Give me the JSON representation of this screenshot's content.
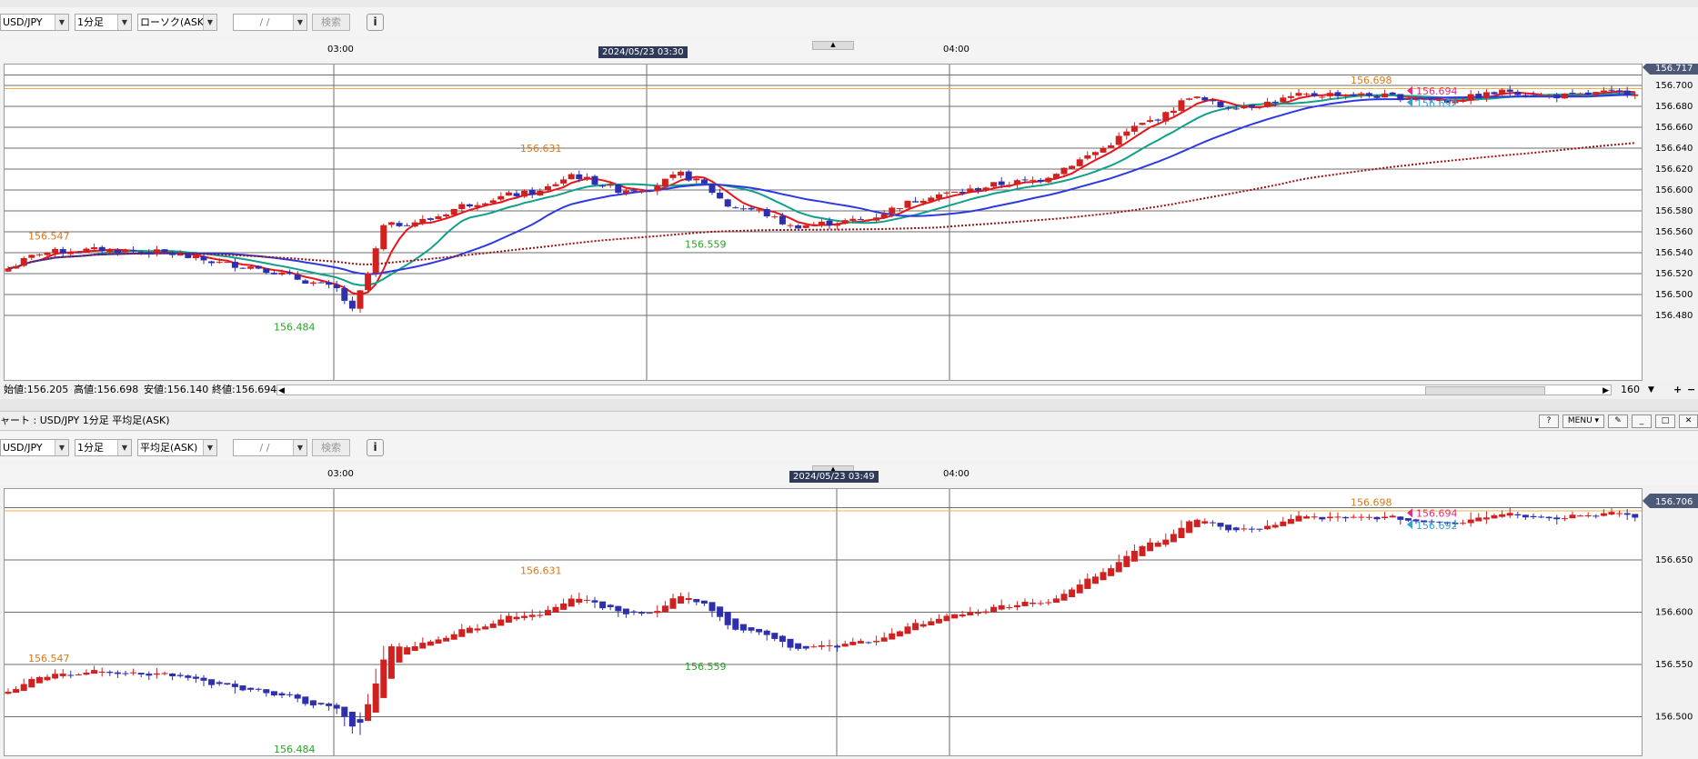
{
  "top_chart": {
    "toolbar": {
      "pair": "USD/JPY",
      "timeframe": "1分足",
      "chart_type": "ローソク(ASK)",
      "date_value": "/ /",
      "search_label": "検索",
      "info_label": "i"
    },
    "time_axis": {
      "labels": [
        "03:00",
        "04:00"
      ],
      "cursor_time": "2024/05/23 03:30"
    },
    "price_axis": {
      "ticks": [
        "156.700",
        "156.680",
        "156.660",
        "156.640",
        "156.620",
        "156.600",
        "156.580",
        "156.560",
        "156.540",
        "156.520",
        "156.500",
        "156.480"
      ],
      "current_tag": "156.717"
    },
    "annotations": {
      "high_1": "156.547",
      "low_1": "156.484",
      "high_2": "156.631",
      "low_2": "156.559",
      "high_3": "156.698",
      "last_ask": "156.694",
      "last_bid": "156.692"
    },
    "status_bar": {
      "open": "始値:156.205",
      "high": "高値:156.698",
      "low": "安値:156.140",
      "close": "終値:156.694",
      "bar_count": "160"
    }
  },
  "bottom_chart": {
    "title": "ャート : USD/JPY 1分足 平均足(ASK)",
    "window_buttons": {
      "help": "?",
      "menu": "MENU ▾",
      "pen": "✎",
      "min": "_",
      "max": "□",
      "close": "✕"
    },
    "toolbar": {
      "pair": "USD/JPY",
      "timeframe": "1分足",
      "chart_type": "平均足(ASK)",
      "date_value": "/ /",
      "search_label": "検索",
      "info_label": "i"
    },
    "time_axis": {
      "labels": [
        "03:00",
        "04:00"
      ],
      "cursor_time": "2024/05/23 03:49"
    },
    "price_axis": {
      "ticks": [
        "156.650",
        "156.600",
        "156.550",
        "156.500"
      ],
      "current_tag": "156.706"
    },
    "annotations": {
      "high_1": "156.547",
      "low_1": "156.484",
      "high_2": "156.631",
      "low_2": "156.559",
      "high_3": "156.698",
      "last_ask": "156.694",
      "last_bid": "156.692"
    }
  },
  "colors": {
    "bull": "#d0201f",
    "bear": "#2d2fae",
    "ma_short": "#e8151a",
    "ma_mid": "#10a08a",
    "ma_long": "#2e3adf",
    "ma_very_long": "#9e1010",
    "high_label": "#d9781a",
    "low_label": "#2aa22a",
    "ask_tag": "#e0307a",
    "bid_tag": "#3aa0d8",
    "price_line": "#f0b040"
  }
}
